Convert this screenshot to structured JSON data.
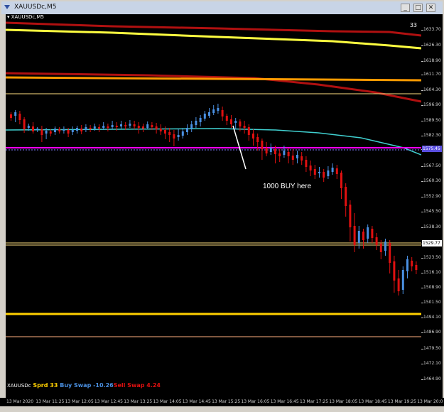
{
  "window": {
    "title": "XAUUSDc,M5"
  },
  "chart": {
    "symbol_label": "XAUUSDc,M5",
    "bar_counter": "33",
    "annotation": "1000 BUY here",
    "info": {
      "symbol": "XAUUSDc",
      "spread_label": "Sprd",
      "spread": "33",
      "buy_swap_label": "Buy Swap",
      "buy_swap": "-10.26",
      "sell_swap_label": "Sell Swap",
      "sell_swap": "4.24"
    },
    "price_labels": [
      "1633.70",
      "1626.30",
      "1618.90",
      "1611.70",
      "1604.30",
      "1596.90",
      "1589.50",
      "1582.30",
      "1575.45",
      "1567.50",
      "1560.30",
      "1552.90",
      "1545.50",
      "1538.30",
      "1529.77",
      "1523.50",
      "1516.10",
      "1508.90",
      "1501.50",
      "1494.10",
      "1486.90",
      "1479.50",
      "1472.10",
      "1464.90"
    ],
    "price_tags": {
      "magenta": "1575.45",
      "white": "1529.77"
    },
    "time_labels": [
      "13 Mar 2020",
      "13 Mar 11:25",
      "13 Mar 12:05",
      "13 Mar 12:45",
      "13 Mar 13:25",
      "13 Mar 14:05",
      "13 Mar 14:45",
      "13 Mar 15:25",
      "13 Mar 16:05",
      "13 Mar 16:45",
      "13 Mar 17:25",
      "13 Mar 18:05",
      "13 Mar 18:45",
      "13 Mar 19:25",
      "13 Mar 20:0"
    ]
  },
  "colors": {
    "background": "#000000",
    "bull_candle": "#4a90e2",
    "bear_candle": "#e01010",
    "ma_cyan": "#40d0d0",
    "ma_yellow": "#ffff40",
    "ma_orange": "#ff9a00",
    "ma_darkred": "#b01010",
    "level_magenta": "#ff00ff",
    "level_yellow": "#ffd000",
    "spread_color": "#ffd000",
    "buy_color": "#4a90e2",
    "sell_color": "#e01010"
  }
}
